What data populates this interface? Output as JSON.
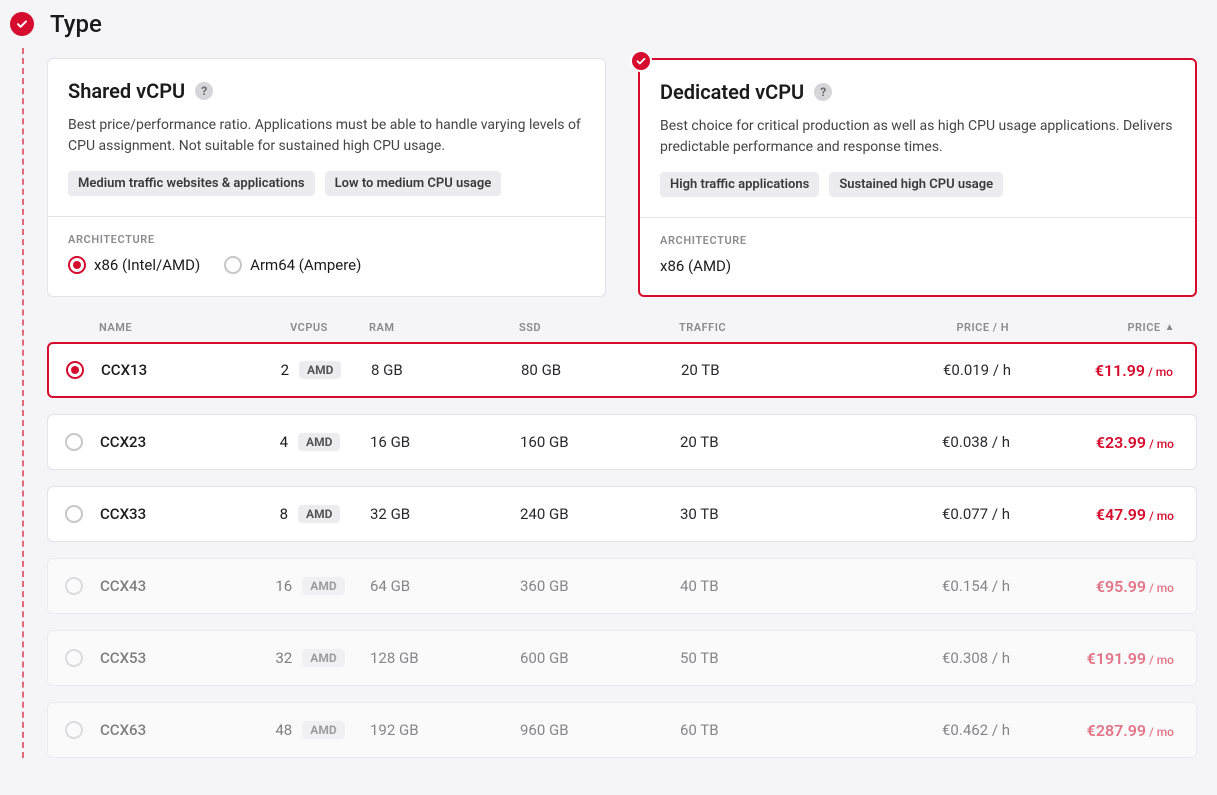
{
  "section": {
    "title": "Type"
  },
  "cards": {
    "shared": {
      "title": "Shared vCPU",
      "desc": "Best price/performance ratio. Applications must be able to handle varying levels of CPU assignment. Not suitable for sustained high CPU usage.",
      "tags": [
        "Medium traffic websites & applications",
        "Low to medium CPU usage"
      ],
      "arch_label": "ARCHITECTURE",
      "arch_options": [
        {
          "label": "x86 (Intel/AMD)",
          "selected": true
        },
        {
          "label": "Arm64 (Ampere)",
          "selected": false
        }
      ],
      "selected": false
    },
    "dedicated": {
      "title": "Dedicated vCPU",
      "desc": "Best choice for critical production as well as high CPU usage applications. Delivers predictable performance and response times.",
      "tags": [
        "High traffic applications",
        "Sustained high CPU usage"
      ],
      "arch_label": "ARCHITECTURE",
      "arch_static": "x86 (AMD)",
      "selected": true
    }
  },
  "headers": {
    "name": "NAME",
    "vcpus": "VCPUS",
    "ram": "RAM",
    "ssd": "SSD",
    "traffic": "TRAFFIC",
    "price_h": "PRICE / H",
    "price": "PRICE"
  },
  "price_suffix": "/ mo",
  "plans": [
    {
      "name": "CCX13",
      "vcpus": "2",
      "vendor": "AMD",
      "ram": "8 GB",
      "ssd": "80 GB",
      "traffic": "20 TB",
      "price_h": "€0.019 / h",
      "price": "€11.99",
      "selected": true,
      "available": true
    },
    {
      "name": "CCX23",
      "vcpus": "4",
      "vendor": "AMD",
      "ram": "16 GB",
      "ssd": "160 GB",
      "traffic": "20 TB",
      "price_h": "€0.038 / h",
      "price": "€23.99",
      "selected": false,
      "available": true
    },
    {
      "name": "CCX33",
      "vcpus": "8",
      "vendor": "AMD",
      "ram": "32 GB",
      "ssd": "240 GB",
      "traffic": "30 TB",
      "price_h": "€0.077 / h",
      "price": "€47.99",
      "selected": false,
      "available": true
    },
    {
      "name": "CCX43",
      "vcpus": "16",
      "vendor": "AMD",
      "ram": "64 GB",
      "ssd": "360 GB",
      "traffic": "40 TB",
      "price_h": "€0.154 / h",
      "price": "€95.99",
      "selected": false,
      "available": false
    },
    {
      "name": "CCX53",
      "vcpus": "32",
      "vendor": "AMD",
      "ram": "128 GB",
      "ssd": "600 GB",
      "traffic": "50 TB",
      "price_h": "€0.308 / h",
      "price": "€191.99",
      "selected": false,
      "available": false
    },
    {
      "name": "CCX63",
      "vcpus": "48",
      "vendor": "AMD",
      "ram": "192 GB",
      "ssd": "960 GB",
      "traffic": "60 TB",
      "price_h": "€0.462 / h",
      "price": "€287.99",
      "selected": false,
      "available": false
    }
  ],
  "colors": {
    "accent": "#d50c2d"
  }
}
